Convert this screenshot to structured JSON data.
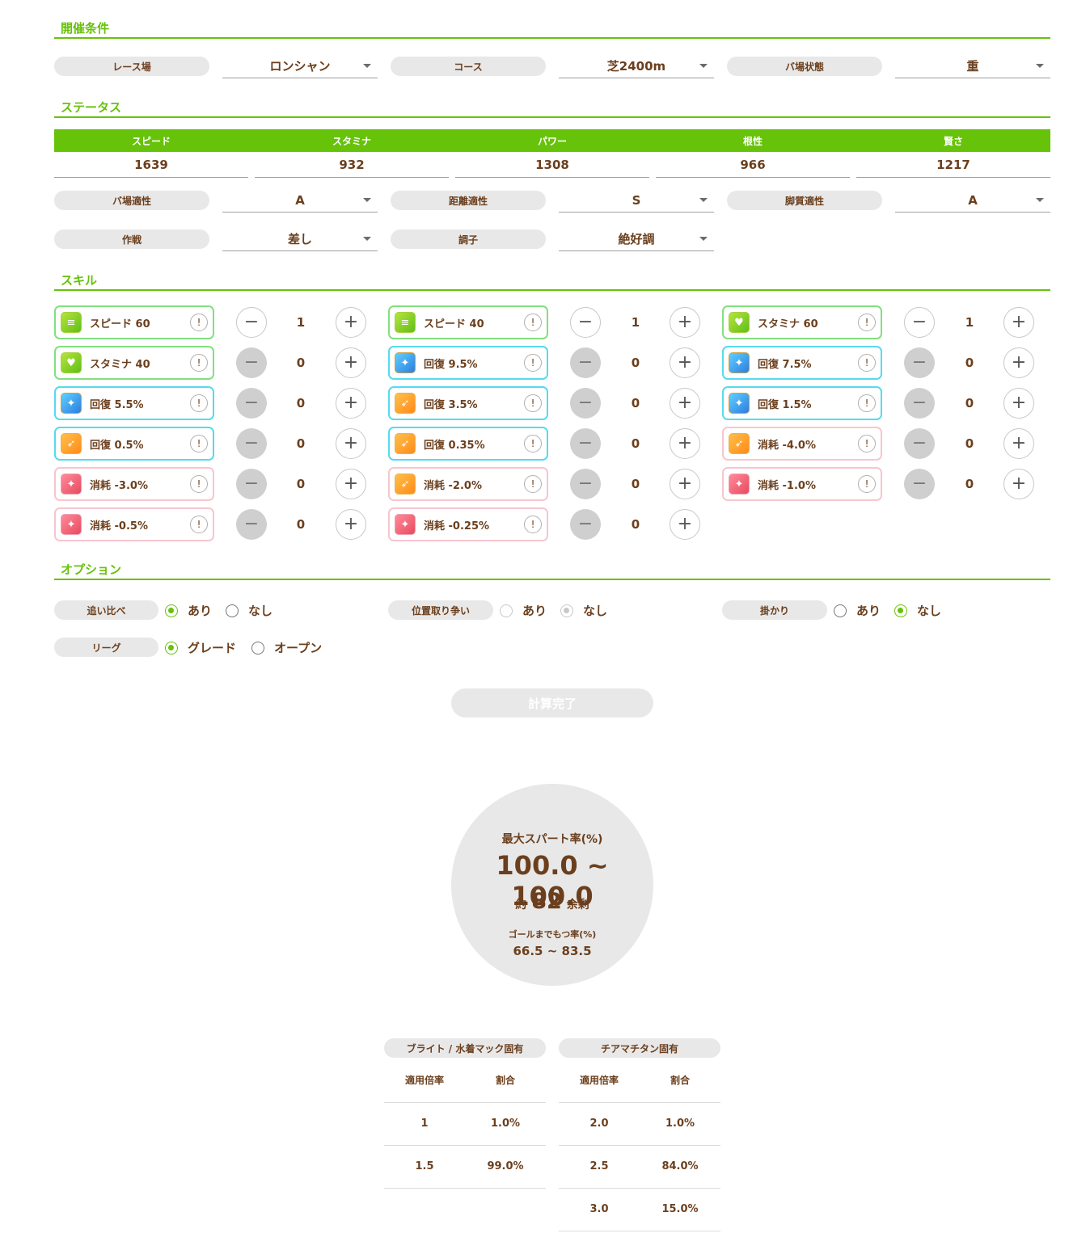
{
  "sections": {
    "conditions": "開催条件",
    "status": "ステータス",
    "skills": "スキル",
    "options": "オプション"
  },
  "conditions": {
    "racecourse_label": "レース場",
    "racecourse_value": "ロンシャン",
    "course_label": "コース",
    "course_value": "芝2400m",
    "track_label": "バ場状態",
    "track_value": "重"
  },
  "status": {
    "headers": [
      "スピード",
      "スタミナ",
      "パワー",
      "根性",
      "賢さ"
    ],
    "values": [
      "1639",
      "932",
      "1308",
      "966",
      "1217"
    ]
  },
  "aptitude": {
    "track_label": "バ場適性",
    "track_value": "A",
    "distance_label": "距離適性",
    "distance_value": "S",
    "style_label": "脚質適性",
    "style_value": "A",
    "strategy_label": "作戦",
    "strategy_value": "差し",
    "mood_label": "調子",
    "mood_value": "絶好調"
  },
  "skills": [
    {
      "name": "スピード 60",
      "icon": "speed-icon",
      "count": "1"
    },
    {
      "name": "スピード 40",
      "icon": "speed-icon",
      "count": "1"
    },
    {
      "name": "スタミナ 60",
      "icon": "heart-icon",
      "count": "1"
    },
    {
      "name": "スタミナ 40",
      "icon": "heart-icon",
      "count": "0"
    },
    {
      "name": "回復 9.5%",
      "icon": "sparkle-icon",
      "count": "0"
    },
    {
      "name": "回復 7.5%",
      "icon": "sparkle-icon",
      "count": "0"
    },
    {
      "name": "回復 5.5%",
      "icon": "sparkle-icon",
      "count": "0"
    },
    {
      "name": "回復 3.5%",
      "icon": "runner-icon",
      "count": "0"
    },
    {
      "name": "回復 1.5%",
      "icon": "sparkle-icon",
      "count": "0"
    },
    {
      "name": "回復 0.5%",
      "icon": "runner-icon",
      "count": "0"
    },
    {
      "name": "回復 0.35%",
      "icon": "runner-icon",
      "count": "0"
    },
    {
      "name": "消耗 -4.0%",
      "icon": "runner-icon",
      "count": "0"
    },
    {
      "name": "消耗 -3.0%",
      "icon": "sparkle-red-icon",
      "count": "0"
    },
    {
      "name": "消耗 -2.0%",
      "icon": "runner-icon",
      "count": "0"
    },
    {
      "name": "消耗 -1.0%",
      "icon": "sparkle-red-icon",
      "count": "0"
    },
    {
      "name": "消耗 -0.5%",
      "icon": "sparkle-red-icon",
      "count": "0"
    },
    {
      "name": "消耗 -0.25%",
      "icon": "sparkle-red-icon",
      "count": "0"
    }
  ],
  "options": {
    "oikurabe_label": "追い比べ",
    "position_label": "位置取り争い",
    "kakari_label": "掛かり",
    "league_label": "リーグ",
    "yes": "あり",
    "no": "なし",
    "grade": "グレード",
    "open": "オープン"
  },
  "calc_button": "計算完了",
  "result": {
    "title": "最大スパート率(%)",
    "range": "100.0 ~ 100.0",
    "approx": "約",
    "remain_value": "82",
    "remain": "余剰",
    "goal_title": "ゴールまでもつ率(%)",
    "goal_range": "66.5 ~ 83.5"
  },
  "tables": [
    {
      "title": "ブライト / 水着マック固有",
      "col1": "適用倍率",
      "col2": "割合",
      "rows": [
        [
          "1",
          "1.0%"
        ],
        [
          "1.5",
          "99.0%"
        ]
      ]
    },
    {
      "title": "チアマチタン固有",
      "col1": "適用倍率",
      "col2": "割合",
      "rows": [
        [
          "2.0",
          "1.0%"
        ],
        [
          "2.5",
          "84.0%"
        ],
        [
          "3.0",
          "15.0%"
        ]
      ]
    }
  ],
  "colors": {
    "accent_green": "#67c20a",
    "text_brown": "#6b3f1d",
    "pill_gray": "#e8e8e8"
  }
}
